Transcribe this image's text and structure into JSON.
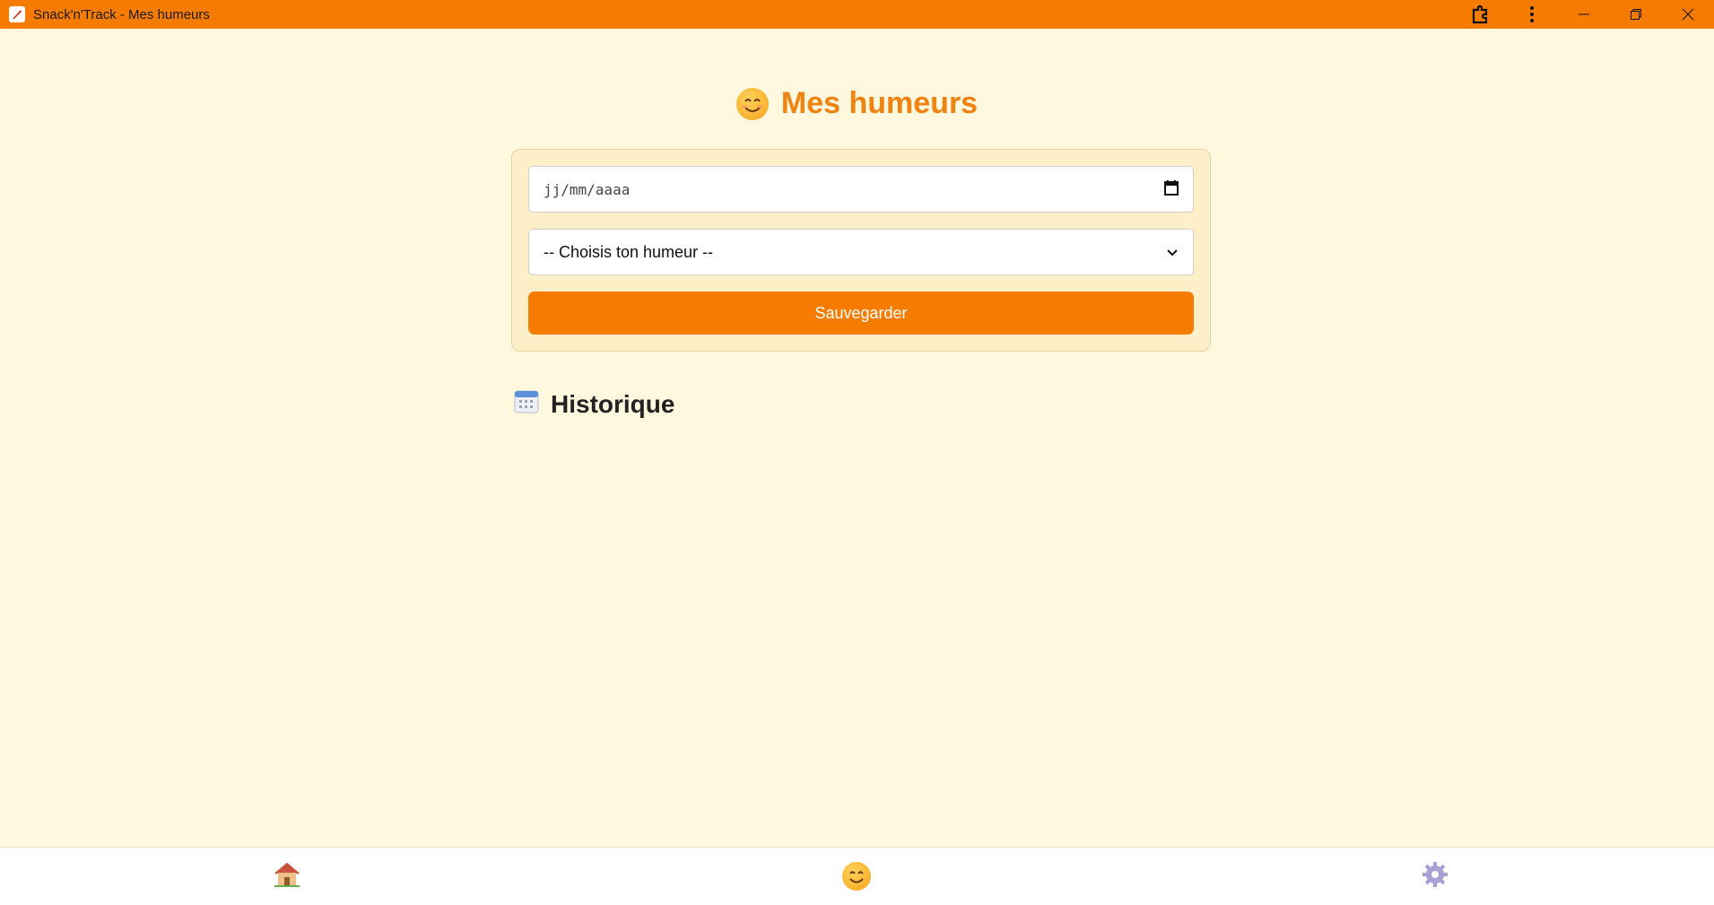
{
  "window": {
    "title": "Snack'n'Track - Mes humeurs",
    "icons": [
      "app-logo-icon",
      "extensions-icon",
      "more-vertical-icon",
      "minimize-icon",
      "restore-icon",
      "close-icon"
    ]
  },
  "header": {
    "emoji": "smiling-face-icon",
    "title": "Mes humeurs"
  },
  "form": {
    "date_placeholder": "jj/mm/aaaa",
    "mood_selected": "-- Choisis ton humeur --",
    "save_label": "Sauvegarder"
  },
  "history": {
    "icon": "calendar-icon",
    "title": "Historique"
  },
  "bottom_nav": {
    "items": [
      {
        "icon": "home-icon"
      },
      {
        "icon": "smiling-face-icon"
      },
      {
        "icon": "gear-icon"
      }
    ]
  },
  "colors": {
    "accent": "#f57c00",
    "title_color": "#f0820f",
    "background": "#fff7de",
    "card": "#fdf0c8"
  }
}
